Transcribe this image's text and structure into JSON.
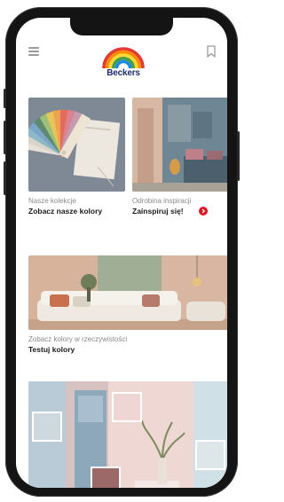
{
  "brand": {
    "name": "Beckers"
  },
  "icons": {
    "menu": "hamburger-menu-icon",
    "bookmark": "bookmark-icon",
    "badge": "arrow-badge-icon"
  },
  "cards": {
    "collections": {
      "subtitle": "Nasze kolekcje",
      "title": "Zobacz nasze kolory"
    },
    "inspirations": {
      "subtitle": "Odrobina inspiracji",
      "title": "Zainspiruj się!"
    },
    "room_view": {
      "subtitle": "Zobacz kolory w rzeczywistości",
      "title": "Testuj kolory"
    }
  },
  "colors": {
    "badge": "#e0161f",
    "logo_word": "#1c2c6e",
    "text_dark": "#1a1a1a",
    "text_muted": "#8a8a8a"
  }
}
